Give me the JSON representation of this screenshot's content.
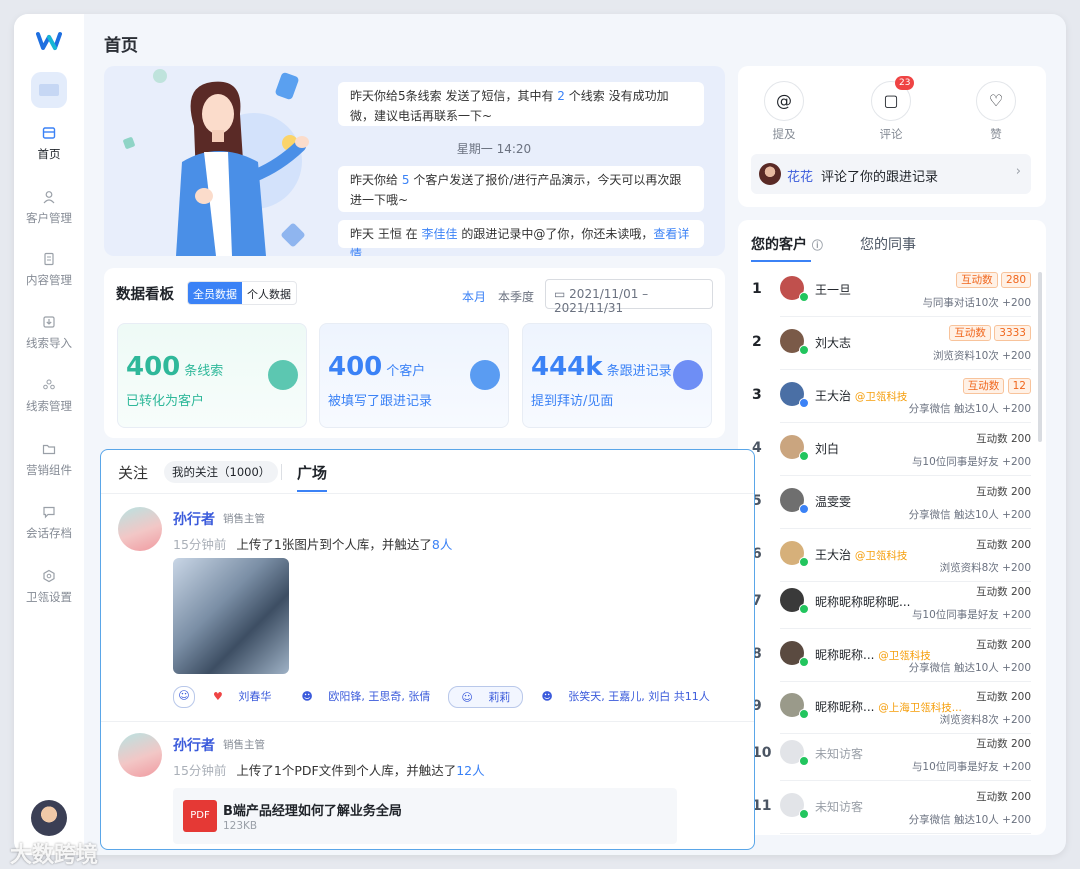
{
  "sidebar": {
    "items": [
      {
        "label": "首页",
        "icon": "home-icon"
      },
      {
        "label": "客户管理",
        "icon": "user-icon"
      },
      {
        "label": "内容管理",
        "icon": "document-icon"
      },
      {
        "label": "线索导入",
        "icon": "import-icon"
      },
      {
        "label": "线索管理",
        "icon": "team-icon"
      },
      {
        "label": "营销组件",
        "icon": "folder-icon"
      },
      {
        "label": "会话存档",
        "icon": "chat-icon"
      },
      {
        "label": "卫瓴设置",
        "icon": "settings-icon"
      }
    ]
  },
  "header": {
    "title": "首页"
  },
  "hero": {
    "msg1_a": "昨天你给5条线索 发送了短信，其中有",
    "msg1_num": "2",
    "msg1_b": "个线索 没有成功加微，建议电话再联系一下~",
    "time": "星期一 14:20",
    "msg2_a": "昨天你给",
    "msg2_num": "5",
    "msg2_b": "个客户发送了报价/进行产品演示，今天可以再次跟进一下哦~",
    "msg3_a": "昨天 王恒 在",
    "msg3_name": "李佳佳",
    "msg3_b": "的跟进记录中@了你，你还未读哦，",
    "msg3_link": "查看详情"
  },
  "dashboard": {
    "title": "数据看板",
    "seg_all": "全员数据",
    "seg_personal": "个人数据",
    "period_month": "本月",
    "period_quarter": "本季度",
    "date_range": "2021/11/01 – 2021/11/31",
    "stats": [
      {
        "num": "400",
        "unit": "条线索",
        "sub": "已转化为客户",
        "color": "#2fb89a"
      },
      {
        "num": "400",
        "unit": "个客户",
        "sub": "被填写了跟进记录",
        "color": "#3b82f6"
      },
      {
        "num": "444k",
        "unit": "条跟进记录",
        "sub": "提到拜访/见面",
        "color": "#3b82f6"
      }
    ]
  },
  "notifications": {
    "mention_label": "提及",
    "comment_label": "评论",
    "comment_count": "23",
    "like_label": "赞",
    "latest_user": "花花",
    "latest_text": "评论了你的跟进记录"
  },
  "customers": {
    "tab_mine": "您的客户",
    "tab_colleague": "您的同事",
    "rows": [
      {
        "rank": "1",
        "name": "王一旦",
        "company": "",
        "inter_label": "互动数",
        "inter": "280",
        "hot": true,
        "desc": "与同事对话10次",
        "delta": "+200"
      },
      {
        "rank": "2",
        "name": "刘大志",
        "company": "",
        "inter_label": "互动数",
        "inter": "3333",
        "hot": true,
        "desc": "浏览资料10次",
        "delta": "+200"
      },
      {
        "rank": "3",
        "name": "王大治",
        "company": "@卫瓴科技",
        "inter_label": "互动数",
        "inter": "12",
        "hot": true,
        "desc": "分享微信 触达10人",
        "delta": "+200"
      },
      {
        "rank": "4",
        "name": "刘白",
        "company": "",
        "inter_label": "互动数",
        "inter": "200",
        "hot": false,
        "desc": "与10位同事是好友",
        "delta": "+200"
      },
      {
        "rank": "5",
        "name": "温雯雯",
        "company": "",
        "inter_label": "互动数",
        "inter": "200",
        "hot": false,
        "desc": "分享微信 触达10人",
        "delta": "+200"
      },
      {
        "rank": "6",
        "name": "王大治",
        "company": "@卫瓴科技",
        "inter_label": "互动数",
        "inter": "200",
        "hot": false,
        "desc": "浏览资料8次",
        "delta": "+200"
      },
      {
        "rank": "7",
        "name": "昵称昵称昵称昵...",
        "company": "",
        "inter_label": "互动数",
        "inter": "200",
        "hot": false,
        "desc": "与10位同事是好友",
        "delta": "+200"
      },
      {
        "rank": "8",
        "name": "昵称昵称...",
        "company": "@卫瓴科技",
        "inter_label": "互动数",
        "inter": "200",
        "hot": false,
        "desc": "分享微信 触达10人",
        "delta": "+200"
      },
      {
        "rank": "9",
        "name": "昵称昵称...",
        "company": "@上海卫瓴科技...",
        "inter_label": "互动数",
        "inter": "200",
        "hot": false,
        "desc": "浏览资料8次",
        "delta": "+200"
      },
      {
        "rank": "10",
        "name": "未知访客",
        "company": "",
        "inter_label": "互动数",
        "inter": "200",
        "hot": false,
        "desc": "与10位同事是好友",
        "delta": "+200"
      },
      {
        "rank": "11",
        "name": "未知访客",
        "company": "",
        "inter_label": "互动数",
        "inter": "200",
        "hot": false,
        "desc": "分享微信 触达10人",
        "delta": "+200"
      }
    ]
  },
  "feed": {
    "tab_follow": "关注",
    "my_follow": "我的关注（1000）",
    "tab_square": "广场",
    "posts": [
      {
        "name": "孙行者",
        "role": "销售主管",
        "time": "15分钟前",
        "text": "上传了1张图片到个人库，并触达了",
        "count": "8人"
      },
      {
        "name": "孙行者",
        "role": "销售主管",
        "time": "15分钟前",
        "text": "上传了1个PDF文件到个人库，并触达了",
        "count": "12人"
      }
    ],
    "reactions": [
      "刘春华",
      "欧阳锋, 王思奇, 张倩",
      "莉莉",
      "张笑天, 王嘉儿, 刘白 共11人"
    ],
    "file_name": "B端产品经理如何了解业务全局",
    "file_size": "123KB"
  },
  "watermark": "大数跨境"
}
